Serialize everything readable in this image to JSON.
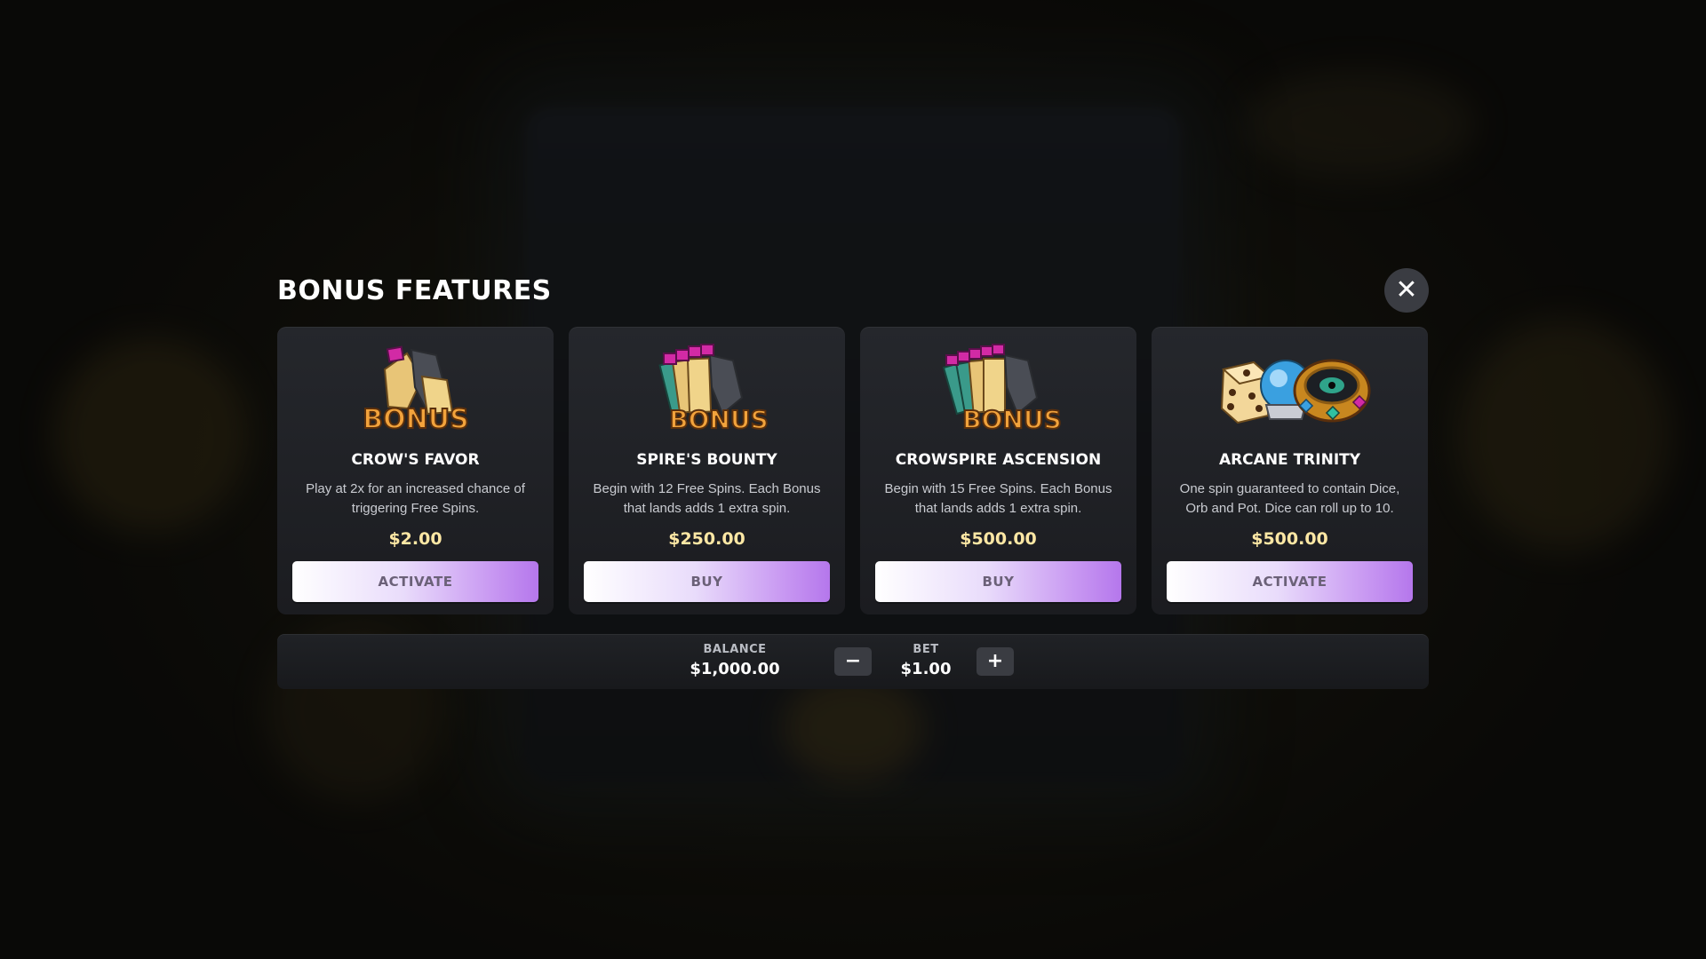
{
  "modal": {
    "title": "BONUS FEATURES",
    "close_symbol": "✕"
  },
  "cards": [
    {
      "title": "CROW'S FAVOR",
      "description": "Play at 2x for an increased chance of triggering Free Spins.",
      "price": "$2.00",
      "button_label": "ACTIVATE",
      "art_icon": "single-bonus-scroll-icon",
      "art_text": "BONUS"
    },
    {
      "title": "SPIRE'S BOUNTY",
      "description": "Begin with 12 Free Spins. Each Bonus that lands adds 1 extra spin.",
      "price": "$250.00",
      "button_label": "BUY",
      "art_icon": "triple-bonus-scroll-icon",
      "art_text": "BONUS"
    },
    {
      "title": "CROWSPIRE ASCENSION",
      "description": "Begin with 15 Free Spins. Each Bonus that lands adds 1 extra spin.",
      "price": "$500.00",
      "button_label": "BUY",
      "art_icon": "quad-bonus-scroll-icon",
      "art_text": "BONUS"
    },
    {
      "title": "ARCANE TRINITY",
      "description": "One spin guaranteed to contain Dice, Orb and Pot. Dice can roll up to 10.",
      "price": "$500.00",
      "button_label": "ACTIVATE",
      "art_icon": "dice-orb-pot-icon"
    }
  ],
  "bet_bar": {
    "balance_label": "BALANCE",
    "balance_value": "$1,000.00",
    "bet_label": "BET",
    "bet_value": "$1.00",
    "minus_symbol": "−",
    "plus_symbol": "+"
  },
  "colors": {
    "price": "#fde7a4",
    "button_gradient_end": "#b577ec",
    "card_bg": "#25272c",
    "gem": "#c0168a"
  }
}
